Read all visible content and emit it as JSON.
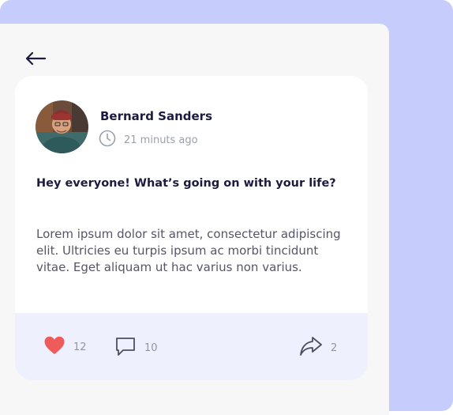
{
  "post": {
    "author": "Bernard Sanders",
    "time": "21 minuts ago",
    "title": "Hey everyone! What’s going on with your life?",
    "body": "Lorem ipsum dolor sit amet, consectetur adipiscing elit. Ultricies eu turpis ipsum ac morbi tincidunt vitae. Eget aliquam ut hac varius non varius."
  },
  "actions": {
    "likes": "12",
    "comments": "10",
    "shares": "2"
  },
  "icons": {
    "back": "arrow-left-icon",
    "clock": "clock-icon",
    "like": "heart-icon",
    "comment": "comment-icon",
    "share": "share-icon"
  },
  "colors": {
    "background_accent": "#c6ccfb",
    "heart": "#ef5a5a",
    "title": "#1d1a3f",
    "actions_bar": "#eef1fd"
  }
}
